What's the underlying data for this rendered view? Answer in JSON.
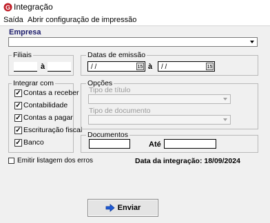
{
  "window": {
    "title": "Integração",
    "icon": "app-g-icon"
  },
  "menu": {
    "items": [
      "Saída",
      "Abrir configuração de impressão"
    ]
  },
  "empresa": {
    "label": "Empresa",
    "value": ""
  },
  "filiais": {
    "label": "Filiais",
    "from": "",
    "sep": "à",
    "to": ""
  },
  "datas": {
    "label": "Datas de emissão",
    "from": "/ /",
    "sep": "à",
    "to": "/ /",
    "cal_glyph": "15"
  },
  "integrar": {
    "label": "Integrar com",
    "items": [
      {
        "label": "Contas a receber",
        "checked": true
      },
      {
        "label": "Contabilidade",
        "checked": true
      },
      {
        "label": "Contas a pagar",
        "checked": true
      },
      {
        "label": "Escrituração fiscal",
        "checked": true
      },
      {
        "label": "Banco",
        "checked": true
      }
    ]
  },
  "opcoes": {
    "label": "Opções",
    "tipo_titulo": "Tipo de título",
    "tipo_documento": "Tipo de documento"
  },
  "documentos": {
    "label": "Documentos",
    "from": "",
    "ate": "Até",
    "to": ""
  },
  "emitir": {
    "label": "Emitir listagem dos erros",
    "checked": false
  },
  "data_integracao": "Data da integração: 18/09/2024",
  "enviar": {
    "label": "Enviar",
    "icon": "arrow-right-icon",
    "color": "#1e5ad6"
  },
  "check_mark": "✓"
}
